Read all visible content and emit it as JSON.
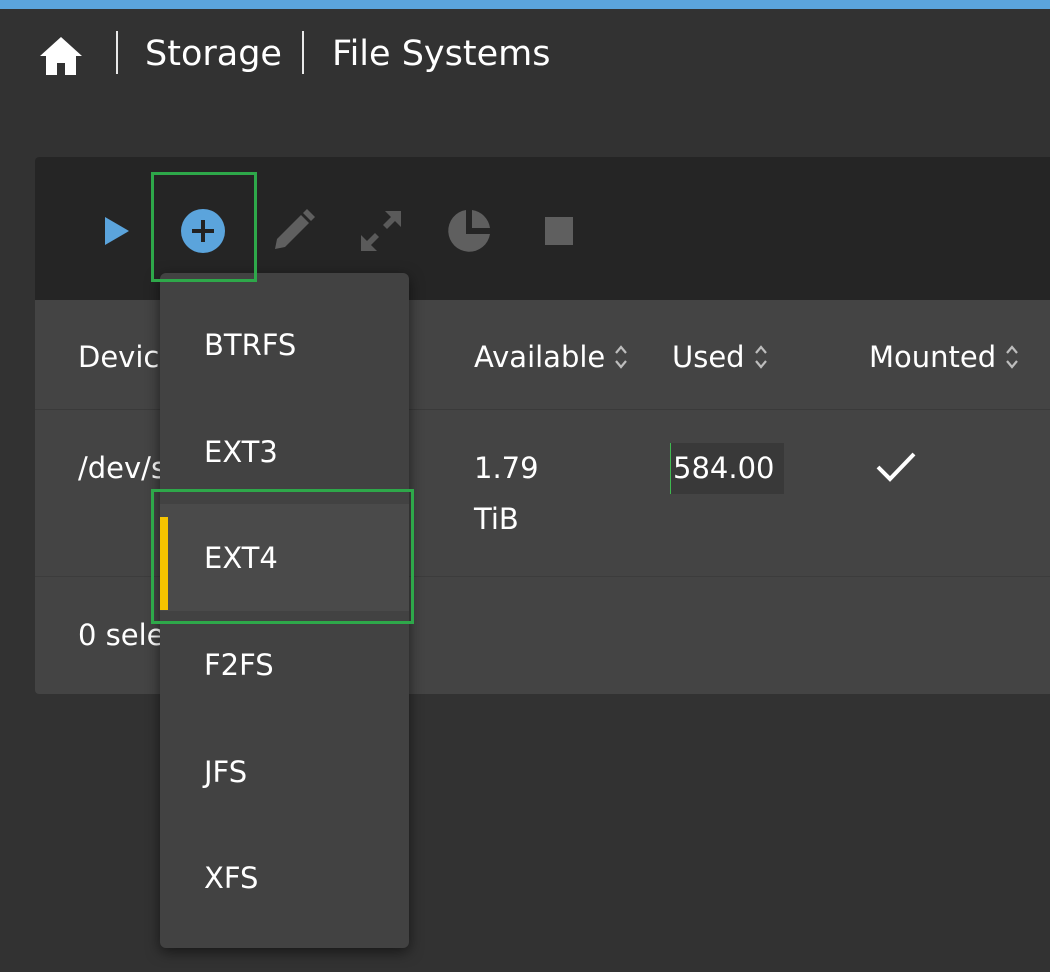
{
  "breadcrumb": {
    "items": [
      "Storage",
      "File Systems"
    ]
  },
  "toolbar": {
    "icons": [
      "play-icon",
      "add-circle-icon",
      "edit-pencil-icon",
      "expand-icon",
      "pie-chart-icon",
      "stop-icon"
    ]
  },
  "table": {
    "headers": {
      "device": "Device",
      "available": "Available",
      "used": "Used",
      "mounted": "Mounted"
    },
    "rows": [
      {
        "device": "/dev/s",
        "available_line1": "1.79",
        "available_line2": "TiB",
        "used": "584.00",
        "mounted": "✓"
      }
    ],
    "footer": "0 sele"
  },
  "dropdown": {
    "items": [
      "BTRFS",
      "EXT3",
      "EXT4",
      "F2FS",
      "JFS",
      "XFS"
    ],
    "selected": "EXT4"
  },
  "colors": {
    "accent": "#5ba4dc",
    "selection_bar": "#f5c400",
    "highlight": "#2ea84a"
  }
}
